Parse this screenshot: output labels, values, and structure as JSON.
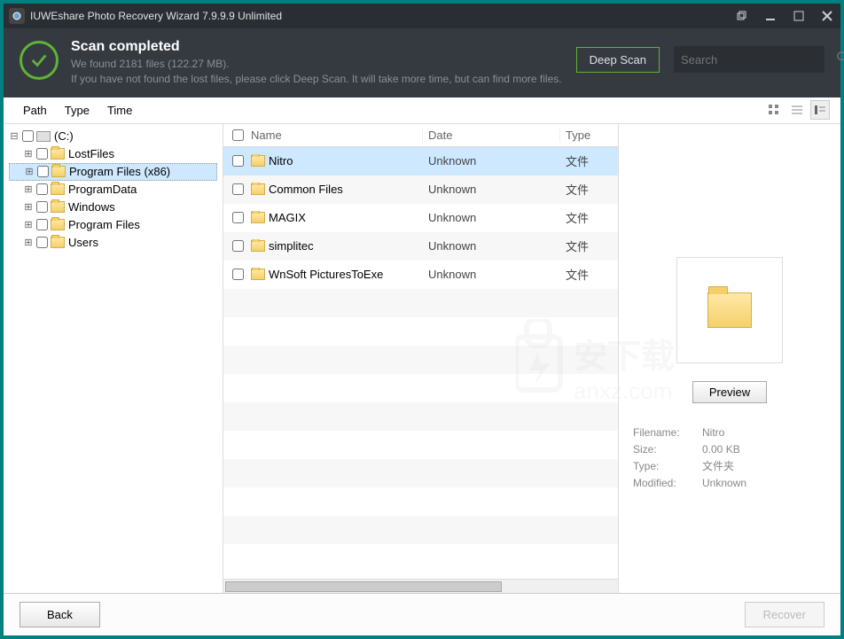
{
  "title": "IUWEshare Photo Recovery Wizard 7.9.9.9 Unlimited",
  "header": {
    "title": "Scan completed",
    "subtitle1": "We found 2181 files (122.27 MB).",
    "subtitle2": "If you have not found the lost files, please click Deep Scan. It will take more time, but can find more files.",
    "deep_scan": "Deep Scan",
    "search_placeholder": "Search"
  },
  "tabs": {
    "path": "Path",
    "type": "Type",
    "time": "Time"
  },
  "tree": {
    "root": "(C:)",
    "items": [
      {
        "label": "LostFiles",
        "selected": false
      },
      {
        "label": "Program Files (x86)",
        "selected": true
      },
      {
        "label": "ProgramData",
        "selected": false
      },
      {
        "label": "Windows",
        "selected": false
      },
      {
        "label": "Program Files",
        "selected": false
      },
      {
        "label": "Users",
        "selected": false
      }
    ]
  },
  "columns": {
    "name": "Name",
    "date": "Date",
    "type": "Type"
  },
  "files": [
    {
      "name": "Nitro",
      "date": "Unknown",
      "type": "文件",
      "selected": true
    },
    {
      "name": "Common Files",
      "date": "Unknown",
      "type": "文件",
      "selected": false
    },
    {
      "name": "MAGIX",
      "date": "Unknown",
      "type": "文件",
      "selected": false
    },
    {
      "name": "simplitec",
      "date": "Unknown",
      "type": "文件",
      "selected": false
    },
    {
      "name": "WnSoft PicturesToExe",
      "date": "Unknown",
      "type": "文件",
      "selected": false
    }
  ],
  "preview": {
    "button": "Preview",
    "filename_label": "Filename:",
    "filename": "Nitro",
    "size_label": "Size:",
    "size": "0.00 KB",
    "type_label": "Type:",
    "type": "文件夹",
    "modified_label": "Modified:",
    "modified": "Unknown"
  },
  "footer": {
    "back": "Back",
    "recover": "Recover"
  },
  "watermark": {
    "line1": "安下载",
    "line2": "anxz.com"
  }
}
